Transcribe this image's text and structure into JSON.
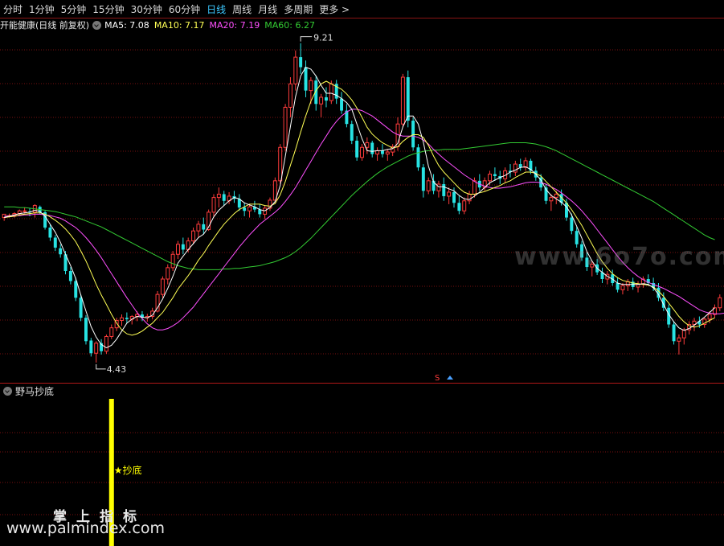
{
  "toolbar": {
    "tabs": [
      {
        "label": "分时",
        "active": false
      },
      {
        "label": "1分钟",
        "active": false
      },
      {
        "label": "5分钟",
        "active": false
      },
      {
        "label": "15分钟",
        "active": false
      },
      {
        "label": "30分钟",
        "active": false
      },
      {
        "label": "60分钟",
        "active": false
      },
      {
        "label": "日线",
        "active": true
      },
      {
        "label": "周线",
        "active": false
      },
      {
        "label": "月线",
        "active": false
      },
      {
        "label": "多周期",
        "active": false
      },
      {
        "label": "更多 >",
        "active": false
      }
    ]
  },
  "title": {
    "stock": "开能健康(日线 前复权)",
    "ma5": "MA5: 7.08",
    "ma10": "MA10: 7.17",
    "ma20": "MA20: 7.19",
    "ma60": "MA60: 6.27"
  },
  "panel2": {
    "title": "野马抄底",
    "signal_label": "★抄底"
  },
  "colors": {
    "up": "#ff3c3c",
    "down": "#27e3e3",
    "ma5": "#ffffff",
    "ma10": "#ffff55",
    "ma20": "#ff50ff",
    "ma60": "#33cc33",
    "grid": "#7a1010",
    "active_tab": "#3cc8ff",
    "signal": "#ffff00"
  },
  "watermarks": {
    "site1": "www.6o7o.com",
    "cn": "掌上指标",
    "site2": "www.palmindex.com"
  },
  "chart_data": {
    "type": "candlestick",
    "ylim": [
      4.2,
      9.35
    ],
    "high_label": "9.21",
    "low_label": "4.43",
    "candles": [
      [
        6.6,
        6.65,
        6.55,
        6.65
      ],
      [
        6.63,
        6.66,
        6.6,
        6.63
      ],
      [
        6.62,
        6.68,
        6.6,
        6.66
      ],
      [
        6.66,
        6.72,
        6.63,
        6.7
      ],
      [
        6.7,
        6.75,
        6.66,
        6.7
      ],
      [
        6.69,
        6.74,
        6.62,
        6.68
      ],
      [
        6.68,
        6.8,
        6.6,
        6.78
      ],
      [
        6.76,
        6.78,
        6.65,
        6.68
      ],
      [
        6.68,
        6.7,
        6.42,
        6.45
      ],
      [
        6.45,
        6.5,
        6.25,
        6.3
      ],
      [
        6.3,
        6.34,
        6.1,
        6.15
      ],
      [
        6.14,
        6.2,
        6.0,
        6.05
      ],
      [
        6.05,
        6.1,
        5.75,
        5.8
      ],
      [
        5.8,
        5.86,
        5.6,
        5.65
      ],
      [
        5.65,
        5.7,
        5.35,
        5.4
      ],
      [
        5.4,
        5.45,
        5.05,
        5.1
      ],
      [
        5.1,
        5.14,
        4.7,
        4.75
      ],
      [
        4.76,
        4.8,
        4.52,
        4.57
      ],
      [
        4.57,
        4.75,
        4.43,
        4.72
      ],
      [
        4.72,
        4.78,
        4.55,
        4.6
      ],
      [
        4.6,
        4.85,
        4.56,
        4.82
      ],
      [
        4.82,
        5.0,
        4.78,
        4.95
      ],
      [
        4.95,
        5.1,
        4.9,
        5.06
      ],
      [
        5.06,
        5.15,
        4.98,
        5.1
      ],
      [
        5.1,
        5.18,
        5.02,
        5.08
      ],
      [
        5.08,
        5.14,
        5.0,
        5.12
      ],
      [
        5.12,
        5.2,
        5.05,
        5.15
      ],
      [
        5.15,
        5.2,
        5.05,
        5.1
      ],
      [
        5.1,
        5.16,
        5.04,
        5.12
      ],
      [
        5.12,
        5.25,
        5.08,
        5.2
      ],
      [
        5.2,
        5.5,
        5.18,
        5.45
      ],
      [
        5.45,
        5.72,
        5.4,
        5.68
      ],
      [
        5.68,
        5.9,
        5.6,
        5.85
      ],
      [
        5.85,
        6.1,
        5.8,
        6.05
      ],
      [
        6.05,
        6.25,
        5.98,
        6.2
      ],
      [
        6.2,
        6.3,
        6.05,
        6.12
      ],
      [
        6.12,
        6.3,
        6.08,
        6.25
      ],
      [
        6.25,
        6.45,
        6.2,
        6.4
      ],
      [
        6.4,
        6.55,
        6.3,
        6.5
      ],
      [
        6.5,
        6.6,
        6.35,
        6.42
      ],
      [
        6.42,
        6.72,
        6.4,
        6.68
      ],
      [
        6.68,
        6.95,
        6.6,
        6.9
      ],
      [
        6.9,
        7.05,
        6.75,
        6.95
      ],
      [
        6.95,
        7.0,
        6.78,
        6.85
      ],
      [
        6.85,
        6.98,
        6.8,
        6.92
      ],
      [
        6.92,
        7.0,
        6.82,
        6.88
      ],
      [
        6.88,
        6.95,
        6.7,
        6.75
      ],
      [
        6.75,
        6.82,
        6.62,
        6.7
      ],
      [
        6.7,
        6.8,
        6.6,
        6.76
      ],
      [
        6.76,
        6.85,
        6.68,
        6.72
      ],
      [
        6.72,
        6.8,
        6.6,
        6.65
      ],
      [
        6.65,
        6.78,
        6.58,
        6.74
      ],
      [
        6.74,
        6.9,
        6.7,
        6.86
      ],
      [
        6.86,
        7.2,
        6.82,
        7.15
      ],
      [
        7.15,
        7.7,
        7.1,
        7.65
      ],
      [
        7.65,
        8.3,
        7.6,
        8.25
      ],
      [
        8.25,
        8.7,
        8.1,
        8.6
      ],
      [
        8.6,
        9.1,
        8.5,
        9.0
      ],
      [
        9.0,
        9.21,
        8.75,
        8.85
      ],
      [
        8.85,
        8.95,
        8.4,
        8.5
      ],
      [
        8.5,
        8.7,
        8.3,
        8.65
      ],
      [
        8.65,
        8.72,
        8.2,
        8.3
      ],
      [
        8.3,
        8.45,
        8.1,
        8.4
      ],
      [
        8.4,
        8.55,
        8.25,
        8.35
      ],
      [
        8.35,
        8.65,
        8.3,
        8.6
      ],
      [
        8.6,
        8.66,
        8.3,
        8.38
      ],
      [
        8.38,
        8.48,
        8.15,
        8.2
      ],
      [
        8.2,
        8.3,
        7.95,
        8.0
      ],
      [
        8.0,
        8.05,
        7.7,
        7.75
      ],
      [
        7.75,
        7.82,
        7.45,
        7.5
      ],
      [
        7.5,
        7.7,
        7.45,
        7.65
      ],
      [
        7.65,
        7.8,
        7.55,
        7.72
      ],
      [
        7.72,
        7.75,
        7.5,
        7.55
      ],
      [
        7.55,
        7.65,
        7.45,
        7.6
      ],
      [
        7.6,
        7.7,
        7.5,
        7.55
      ],
      [
        7.55,
        7.62,
        7.45,
        7.58
      ],
      [
        7.58,
        7.7,
        7.52,
        7.66
      ],
      [
        7.66,
        8.1,
        7.6,
        8.0
      ],
      [
        8.0,
        8.75,
        7.95,
        8.7
      ],
      [
        8.7,
        8.8,
        7.95,
        8.05
      ],
      [
        8.05,
        8.1,
        7.6,
        7.65
      ],
      [
        7.65,
        7.7,
        7.3,
        7.35
      ],
      [
        7.35,
        7.4,
        6.9,
        7.0
      ],
      [
        7.0,
        7.2,
        6.95,
        7.15
      ],
      [
        7.15,
        7.25,
        6.95,
        7.0
      ],
      [
        7.0,
        7.15,
        6.9,
        7.1
      ],
      [
        7.1,
        7.2,
        6.85,
        6.92
      ],
      [
        6.92,
        7.05,
        6.8,
        6.98
      ],
      [
        6.98,
        7.05,
        6.75,
        6.82
      ],
      [
        6.82,
        6.92,
        6.65,
        6.7
      ],
      [
        6.7,
        6.9,
        6.65,
        6.85
      ],
      [
        6.85,
        7.0,
        6.8,
        6.95
      ],
      [
        6.95,
        7.2,
        6.9,
        7.15
      ],
      [
        7.15,
        7.25,
        7.0,
        7.05
      ],
      [
        7.05,
        7.2,
        7.0,
        7.15
      ],
      [
        7.15,
        7.3,
        7.08,
        7.25
      ],
      [
        7.25,
        7.35,
        7.15,
        7.22
      ],
      [
        7.22,
        7.3,
        7.1,
        7.18
      ],
      [
        7.18,
        7.35,
        7.12,
        7.3
      ],
      [
        7.3,
        7.4,
        7.2,
        7.28
      ],
      [
        7.28,
        7.45,
        7.22,
        7.4
      ],
      [
        7.4,
        7.48,
        7.3,
        7.35
      ],
      [
        7.35,
        7.5,
        7.3,
        7.45
      ],
      [
        7.45,
        7.48,
        7.25,
        7.3
      ],
      [
        7.3,
        7.36,
        7.15,
        7.2
      ],
      [
        7.2,
        7.25,
        7.0,
        7.05
      ],
      [
        7.05,
        7.1,
        6.8,
        6.85
      ],
      [
        6.85,
        6.95,
        6.7,
        6.9
      ],
      [
        6.9,
        7.0,
        6.8,
        6.95
      ],
      [
        6.95,
        7.02,
        6.78,
        6.82
      ],
      [
        6.82,
        6.88,
        6.55,
        6.6
      ],
      [
        6.6,
        6.66,
        6.35,
        6.4
      ],
      [
        6.4,
        6.46,
        6.15,
        6.2
      ],
      [
        6.2,
        6.25,
        5.95,
        6.0
      ],
      [
        6.0,
        6.08,
        5.8,
        5.86
      ],
      [
        5.86,
        5.95,
        5.72,
        5.9
      ],
      [
        5.9,
        5.98,
        5.74,
        5.78
      ],
      [
        5.78,
        5.85,
        5.62,
        5.68
      ],
      [
        5.68,
        5.8,
        5.6,
        5.75
      ],
      [
        5.75,
        5.82,
        5.58,
        5.62
      ],
      [
        5.62,
        5.7,
        5.48,
        5.52
      ],
      [
        5.52,
        5.62,
        5.45,
        5.58
      ],
      [
        5.58,
        5.68,
        5.5,
        5.64
      ],
      [
        5.64,
        5.7,
        5.52,
        5.56
      ],
      [
        5.56,
        5.65,
        5.48,
        5.6
      ],
      [
        5.6,
        5.72,
        5.55,
        5.68
      ],
      [
        5.68,
        5.75,
        5.58,
        5.62
      ],
      [
        5.62,
        5.7,
        5.5,
        5.55
      ],
      [
        5.55,
        5.62,
        5.35,
        5.4
      ],
      [
        5.4,
        5.48,
        5.2,
        5.25
      ],
      [
        5.25,
        5.3,
        4.95,
        5.0
      ],
      [
        5.0,
        5.05,
        4.7,
        4.75
      ],
      [
        4.75,
        4.85,
        4.55,
        4.8
      ],
      [
        4.8,
        4.95,
        4.7,
        4.92
      ],
      [
        4.92,
        5.05,
        4.85,
        5.0
      ],
      [
        5.0,
        5.1,
        4.9,
        5.05
      ],
      [
        5.05,
        5.12,
        4.95,
        5.0
      ],
      [
        5.0,
        5.1,
        4.95,
        5.08
      ],
      [
        5.08,
        5.2,
        5.02,
        5.15
      ],
      [
        5.15,
        5.3,
        5.1,
        5.25
      ],
      [
        5.25,
        5.45,
        5.2,
        5.4
      ]
    ],
    "ma5": [
      6.6,
      6.62,
      6.64,
      6.66,
      6.67,
      6.68,
      6.71,
      6.69,
      6.62,
      6.5,
      6.38,
      6.23,
      6.05,
      5.88,
      5.69,
      5.44,
      5.2,
      4.97,
      4.81,
      4.7,
      4.65,
      4.69,
      4.78,
      4.9,
      5.02,
      5.08,
      5.12,
      5.11,
      5.1,
      5.14,
      5.25,
      5.38,
      5.54,
      5.72,
      5.92,
      6.02,
      6.12,
      6.21,
      6.3,
      6.35,
      6.46,
      6.61,
      6.71,
      6.78,
      6.85,
      6.9,
      6.88,
      6.82,
      6.79,
      6.76,
      6.72,
      6.7,
      6.75,
      6.84,
      7.08,
      7.52,
      7.96,
      8.41,
      8.72,
      8.85,
      8.82,
      8.72,
      8.58,
      8.46,
      8.46,
      8.43,
      8.38,
      8.32,
      8.22,
      8.0,
      7.78,
      7.6,
      7.59,
      7.6,
      7.6,
      7.62,
      7.63,
      7.71,
      7.96,
      8.12,
      8.12,
      8.0,
      7.73,
      7.37,
      7.13,
      7.06,
      7.06,
      7.03,
      7.0,
      6.93,
      6.88,
      6.87,
      6.92,
      6.98,
      7.05,
      7.12,
      7.16,
      7.2,
      7.23,
      7.28,
      7.31,
      7.35,
      7.36,
      7.32,
      7.25,
      7.16,
      7.02,
      6.93,
      6.88,
      6.83,
      6.76,
      6.64,
      6.47,
      6.29,
      6.09,
      5.95,
      5.84,
      5.78,
      5.72,
      5.68,
      5.62,
      5.6,
      5.6,
      5.6,
      5.6,
      5.61,
      5.6,
      5.55,
      5.45,
      5.3,
      5.15,
      5.04,
      4.95,
      4.91,
      4.94,
      4.99,
      5.05,
      5.11,
      5.18,
      5.25
    ],
    "ma10": [
      6.6,
      6.61,
      6.62,
      6.64,
      6.65,
      6.66,
      6.67,
      6.67,
      6.65,
      6.61,
      6.56,
      6.5,
      6.43,
      6.34,
      6.24,
      6.1,
      5.95,
      5.78,
      5.6,
      5.44,
      5.3,
      5.15,
      5.02,
      4.92,
      4.86,
      4.84,
      4.86,
      4.9,
      4.96,
      5.02,
      5.1,
      5.18,
      5.29,
      5.4,
      5.53,
      5.63,
      5.73,
      5.84,
      5.96,
      6.06,
      6.18,
      6.29,
      6.4,
      6.5,
      6.58,
      6.66,
      6.72,
      6.76,
      6.8,
      6.8,
      6.8,
      6.78,
      6.77,
      6.81,
      6.94,
      7.14,
      7.38,
      7.62,
      7.88,
      8.12,
      8.34,
      8.5,
      8.6,
      8.64,
      8.6,
      8.56,
      8.52,
      8.45,
      8.36,
      8.24,
      8.1,
      7.95,
      7.85,
      7.78,
      7.72,
      7.68,
      7.64,
      7.66,
      7.74,
      7.8,
      7.84,
      7.84,
      7.8,
      7.68,
      7.52,
      7.38,
      7.28,
      7.2,
      7.12,
      7.04,
      6.98,
      6.95,
      6.95,
      6.97,
      6.99,
      7.02,
      7.05,
      7.08,
      7.12,
      7.15,
      7.2,
      7.24,
      7.28,
      7.28,
      7.26,
      7.22,
      7.14,
      7.06,
      6.98,
      6.9,
      6.82,
      6.72,
      6.6,
      6.48,
      6.34,
      6.2,
      6.06,
      5.94,
      5.84,
      5.76,
      5.7,
      5.66,
      5.64,
      5.62,
      5.61,
      5.6,
      5.59,
      5.56,
      5.5,
      5.42,
      5.32,
      5.22,
      5.12,
      5.04,
      4.98,
      4.96,
      4.98,
      5.02,
      5.06,
      5.1
    ],
    "ma20": [
      6.62,
      6.62,
      6.63,
      6.63,
      6.64,
      6.64,
      6.65,
      6.65,
      6.64,
      6.63,
      6.61,
      6.59,
      6.55,
      6.5,
      6.45,
      6.38,
      6.3,
      6.21,
      6.11,
      6.0,
      5.88,
      5.76,
      5.64,
      5.52,
      5.4,
      5.29,
      5.18,
      5.09,
      5.01,
      4.95,
      4.92,
      4.92,
      4.94,
      4.98,
      5.03,
      5.1,
      5.18,
      5.26,
      5.36,
      5.46,
      5.56,
      5.66,
      5.76,
      5.86,
      5.96,
      6.06,
      6.16,
      6.25,
      6.34,
      6.42,
      6.5,
      6.56,
      6.62,
      6.68,
      6.75,
      6.84,
      6.94,
      7.05,
      7.18,
      7.31,
      7.44,
      7.57,
      7.7,
      7.82,
      7.94,
      8.04,
      8.12,
      8.18,
      8.22,
      8.22,
      8.2,
      8.16,
      8.12,
      8.06,
      8.0,
      7.94,
      7.88,
      7.84,
      7.82,
      7.82,
      7.82,
      7.8,
      7.76,
      7.7,
      7.62,
      7.55,
      7.48,
      7.42,
      7.36,
      7.3,
      7.24,
      7.19,
      7.14,
      7.1,
      7.07,
      7.05,
      7.04,
      7.04,
      7.05,
      7.06,
      7.08,
      7.1,
      7.12,
      7.13,
      7.13,
      7.12,
      7.1,
      7.06,
      7.02,
      6.97,
      6.91,
      6.85,
      6.78,
      6.7,
      6.61,
      6.52,
      6.42,
      6.32,
      6.22,
      6.12,
      6.02,
      5.93,
      5.85,
      5.78,
      5.72,
      5.67,
      5.63,
      5.6,
      5.57,
      5.54,
      5.5,
      5.46,
      5.42,
      5.37,
      5.32,
      5.27,
      5.22,
      5.19,
      5.17,
      5.16,
      5.16,
      5.17
    ],
    "ma60": [
      6.76,
      6.76,
      6.76,
      6.75,
      6.75,
      6.74,
      6.73,
      6.72,
      6.71,
      6.7,
      6.69,
      6.67,
      6.65,
      6.63,
      6.61,
      6.58,
      6.55,
      6.52,
      6.49,
      6.46,
      6.42,
      6.38,
      6.34,
      6.3,
      6.26,
      6.22,
      6.18,
      6.14,
      6.1,
      6.06,
      6.02,
      5.98,
      5.94,
      5.91,
      5.88,
      5.86,
      5.84,
      5.83,
      5.82,
      5.82,
      5.82,
      5.82,
      5.82,
      5.83,
      5.83,
      5.84,
      5.84,
      5.85,
      5.86,
      5.87,
      5.88,
      5.9,
      5.92,
      5.94,
      5.97,
      6.0,
      6.04,
      6.09,
      6.15,
      6.22,
      6.29,
      6.37,
      6.45,
      6.53,
      6.61,
      6.69,
      6.77,
      6.85,
      6.93,
      7.0,
      7.07,
      7.14,
      7.2,
      7.26,
      7.31,
      7.36,
      7.4,
      7.44,
      7.48,
      7.52,
      7.55,
      7.57,
      7.59,
      7.6,
      7.61,
      7.61,
      7.62,
      7.62,
      7.62,
      7.62,
      7.63,
      7.64,
      7.65,
      7.66,
      7.67,
      7.68,
      7.69,
      7.7,
      7.71,
      7.72,
      7.72,
      7.72,
      7.72,
      7.71,
      7.7,
      7.68,
      7.66,
      7.63,
      7.6,
      7.56,
      7.52,
      7.48,
      7.44,
      7.4,
      7.36,
      7.32,
      7.28,
      7.24,
      7.2,
      7.16,
      7.12,
      7.08,
      7.04,
      7.0,
      6.96,
      6.92,
      6.88,
      6.84,
      6.79,
      6.74,
      6.69,
      6.64,
      6.59,
      6.54,
      6.49,
      6.44,
      6.39,
      6.34,
      6.3,
      6.27
    ],
    "signal_index": 21
  }
}
